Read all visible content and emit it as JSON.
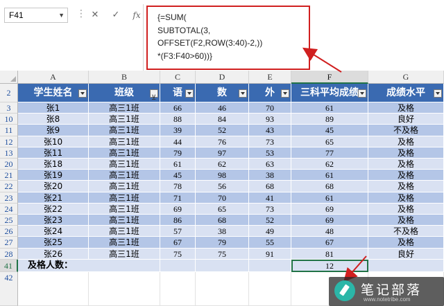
{
  "formula_bar": {
    "name_box": "F41",
    "cancel_icon": "✕",
    "enter_icon": "✓",
    "fx_label": "fx",
    "formula_lines": [
      "{=SUM(",
      "SUBTOTAL(3,",
      "OFFSET(F2,ROW(3:40)-2,))",
      "*(F3:F40>60))}"
    ]
  },
  "columns": [
    "A",
    "B",
    "C",
    "D",
    "E",
    "F",
    "G"
  ],
  "selected_column": "F",
  "headers": [
    "学生姓名",
    "班级",
    "语",
    "数",
    "外",
    "三科平均成绩",
    "成绩水平"
  ],
  "filtered_column_index": 1,
  "header_row_number": "2",
  "rows": [
    {
      "row": "3",
      "cells": [
        "张1",
        "高三1班",
        "66",
        "46",
        "70",
        "61",
        "及格"
      ]
    },
    {
      "row": "10",
      "cells": [
        "张8",
        "高三1班",
        "88",
        "84",
        "93",
        "89",
        "良好"
      ]
    },
    {
      "row": "11",
      "cells": [
        "张9",
        "高三1班",
        "39",
        "52",
        "43",
        "45",
        "不及格"
      ]
    },
    {
      "row": "12",
      "cells": [
        "张10",
        "高三1班",
        "44",
        "76",
        "73",
        "65",
        "及格"
      ]
    },
    {
      "row": "13",
      "cells": [
        "张11",
        "高三1班",
        "79",
        "97",
        "53",
        "77",
        "及格"
      ]
    },
    {
      "row": "20",
      "cells": [
        "张18",
        "高三1班",
        "61",
        "62",
        "63",
        "62",
        "及格"
      ]
    },
    {
      "row": "21",
      "cells": [
        "张19",
        "高三1班",
        "45",
        "98",
        "38",
        "61",
        "及格"
      ]
    },
    {
      "row": "22",
      "cells": [
        "张20",
        "高三1班",
        "78",
        "56",
        "68",
        "68",
        "及格"
      ]
    },
    {
      "row": "23",
      "cells": [
        "张21",
        "高三1班",
        "71",
        "70",
        "41",
        "61",
        "及格"
      ]
    },
    {
      "row": "24",
      "cells": [
        "张22",
        "高三1班",
        "69",
        "65",
        "73",
        "69",
        "及格"
      ]
    },
    {
      "row": "25",
      "cells": [
        "张23",
        "高三1班",
        "86",
        "68",
        "52",
        "69",
        "及格"
      ]
    },
    {
      "row": "26",
      "cells": [
        "张24",
        "高三1班",
        "57",
        "38",
        "49",
        "48",
        "不及格"
      ]
    },
    {
      "row": "27",
      "cells": [
        "张25",
        "高三1班",
        "67",
        "79",
        "55",
        "67",
        "及格"
      ]
    },
    {
      "row": "28",
      "cells": [
        "张26",
        "高三1班",
        "75",
        "75",
        "91",
        "81",
        "良好"
      ]
    }
  ],
  "footer": {
    "row": "41",
    "label": "及格人数：",
    "value": "12"
  },
  "extra_row": "42",
  "watermark": {
    "title": "笔记部落",
    "url": "www.notetribe.com"
  },
  "colors": {
    "header_blue": "#3a6ab1",
    "band_dark": "#b4c6e7",
    "band_light": "#d9e1f2",
    "callout_red": "#d01f1f",
    "select_green": "#217346"
  }
}
